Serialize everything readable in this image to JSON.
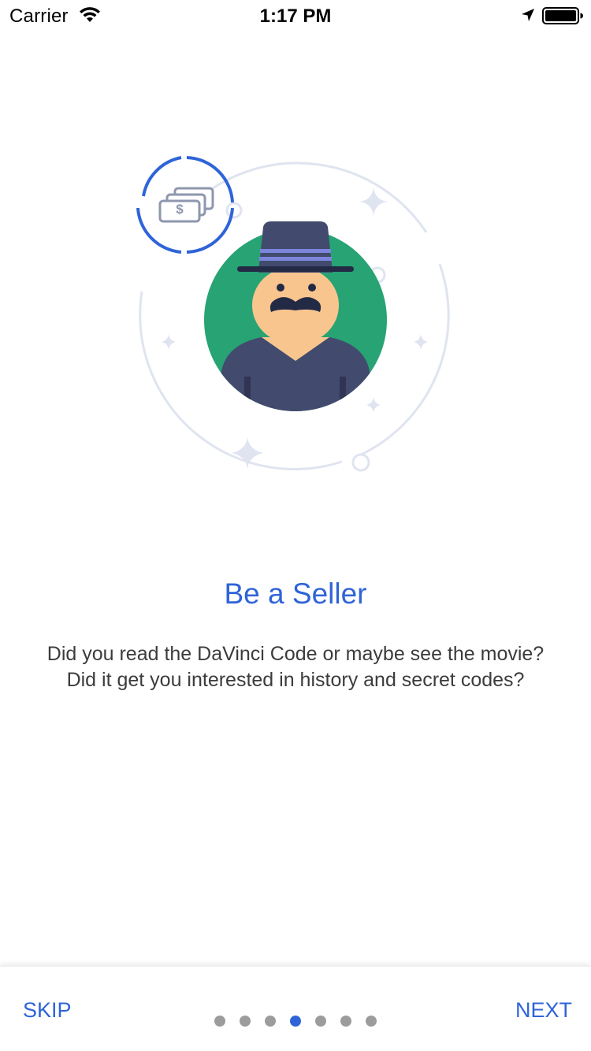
{
  "status_bar": {
    "carrier": "Carrier",
    "time": "1:17 PM",
    "wifi_icon": "wifi-icon",
    "location_icon": "location-arrow-icon",
    "battery_icon": "battery-icon"
  },
  "onboarding": {
    "illustration_icon": "seller-character-illustration",
    "badge_icon": "money-bills-icon",
    "badge_symbol": "$",
    "title": "Be a Seller",
    "description": "Did you read the DaVinci Code or maybe see the movie? Did it get you interested in history and secret codes?"
  },
  "navigation": {
    "skip_label": "SKIP",
    "next_label": "NEXT",
    "page_count": 7,
    "current_page": 4
  },
  "colors": {
    "accent": "#2f64d8",
    "dot_inactive": "#9c9c9c",
    "avatar_background": "#27a374",
    "character_dark": "#424a6e",
    "skin": "#f9c58e",
    "ring": "#dfe4f0"
  }
}
